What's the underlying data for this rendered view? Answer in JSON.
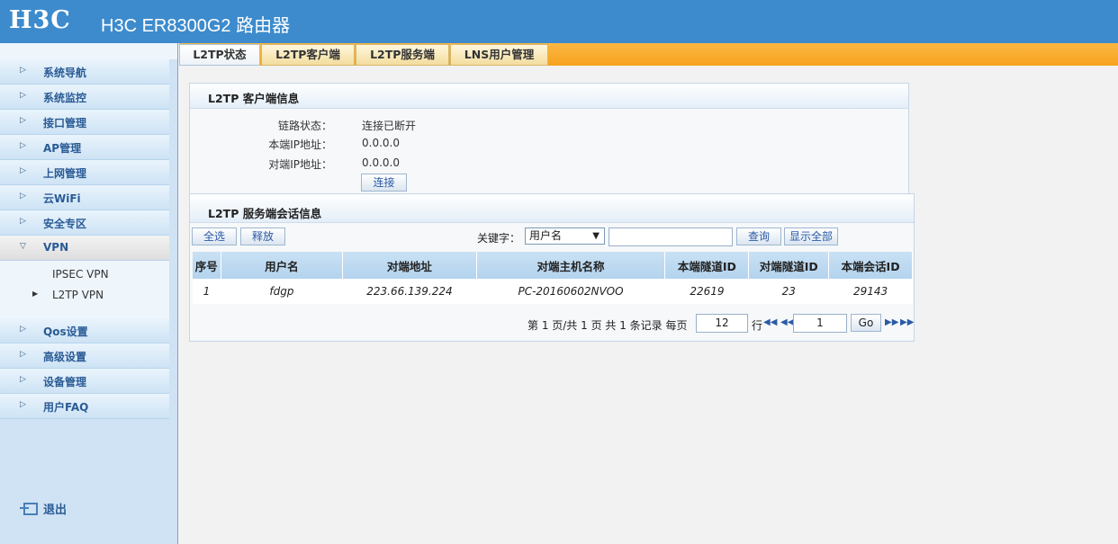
{
  "header": {
    "logo": "H3C",
    "title": "H3C ER8300G2 路由器"
  },
  "sidebar": {
    "items": [
      {
        "label": "系统导航"
      },
      {
        "label": "系统监控"
      },
      {
        "label": "接口管理"
      },
      {
        "label": "AP管理"
      },
      {
        "label": "上网管理"
      },
      {
        "label": "云WiFi"
      },
      {
        "label": "安全专区"
      },
      {
        "label": "VPN"
      },
      {
        "label": "Qos设置"
      },
      {
        "label": "高级设置"
      },
      {
        "label": "设备管理"
      },
      {
        "label": "用户FAQ"
      }
    ],
    "vpn_sub": [
      {
        "label": "IPSEC VPN"
      },
      {
        "label": "L2TP VPN"
      }
    ],
    "logout": "退出"
  },
  "tabs": [
    {
      "label": "L2TP状态",
      "active": true
    },
    {
      "label": "L2TP客户端"
    },
    {
      "label": "L2TP服务端"
    },
    {
      "label": "LNS用户管理"
    }
  ],
  "client_panel": {
    "title": "L2TP 客户端信息",
    "rows": [
      {
        "label": "链路状态：",
        "value": "连接已断开"
      },
      {
        "label": "本端IP地址：",
        "value": "0.0.0.0"
      },
      {
        "label": "对端IP地址：",
        "value": "0.0.0.0"
      }
    ],
    "connect_label": "连接"
  },
  "server_panel": {
    "title": "L2TP 服务端会话信息",
    "select_all": "全选",
    "release": "释放",
    "keyword_label": "关键字：",
    "keyword_option": "用户名",
    "keyword_value": "",
    "query": "查询",
    "show_all": "显示全部",
    "columns": [
      "序号",
      "用户名",
      "对端地址",
      "对端主机名称",
      "本端隧道ID",
      "对端隧道ID",
      "本端会话ID"
    ],
    "rows": [
      [
        "1",
        "fdgp",
        "223.66.139.224",
        "PC-20160602NVOO",
        "22619",
        "23",
        "29143"
      ]
    ],
    "pager": {
      "summary": "第 1 页/共 1 页 共 1 条记录 每页",
      "per_page": "12",
      "row_unit": "行",
      "page": "1",
      "go": "Go"
    }
  },
  "colors": {
    "header": "#3d8bcd",
    "tabbar": "#f7a21e",
    "table_head": "#b3d3ee"
  }
}
